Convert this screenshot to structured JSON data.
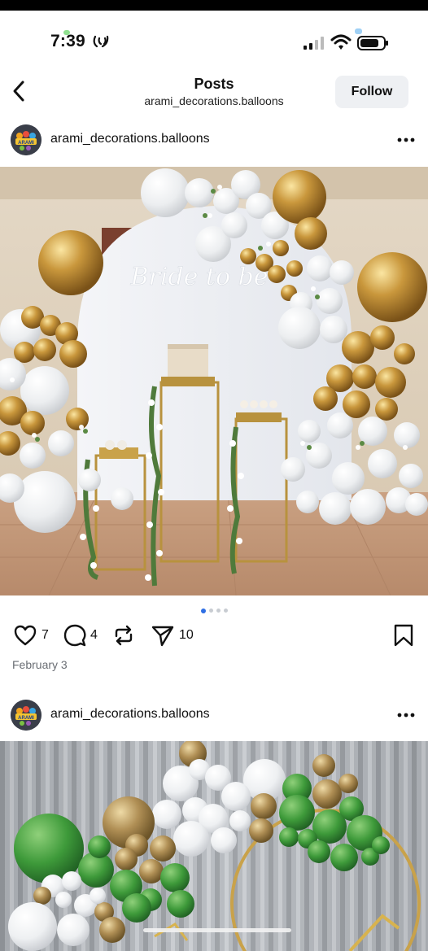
{
  "status_bar": {
    "time": "7:39"
  },
  "nav": {
    "title": "Posts",
    "subtitle": "arami_decorations.balloons",
    "follow_label": "Follow"
  },
  "posts": [
    {
      "username": "arami_decorations.balloons",
      "avatar_text": "ARAMI",
      "image_script_text": "Bride to be",
      "carousel_pages": 4,
      "carousel_active": 1,
      "likes": "7",
      "comments": "4",
      "shares": "10",
      "date": "February 3"
    },
    {
      "username": "arami_decorations.balloons",
      "avatar_text": "ARAMI"
    }
  ],
  "icons": [
    "back-chevron-icon",
    "hotspot-icon",
    "signal-icon",
    "wifi-icon",
    "battery-icon",
    "more-icon",
    "heart-icon",
    "comment-icon",
    "repost-icon",
    "send-icon",
    "bookmark-icon"
  ],
  "colors": {
    "follow_bg": "#eef0f3",
    "carousel_active": "#2f6fe4",
    "date_text": "#6a6e74"
  }
}
